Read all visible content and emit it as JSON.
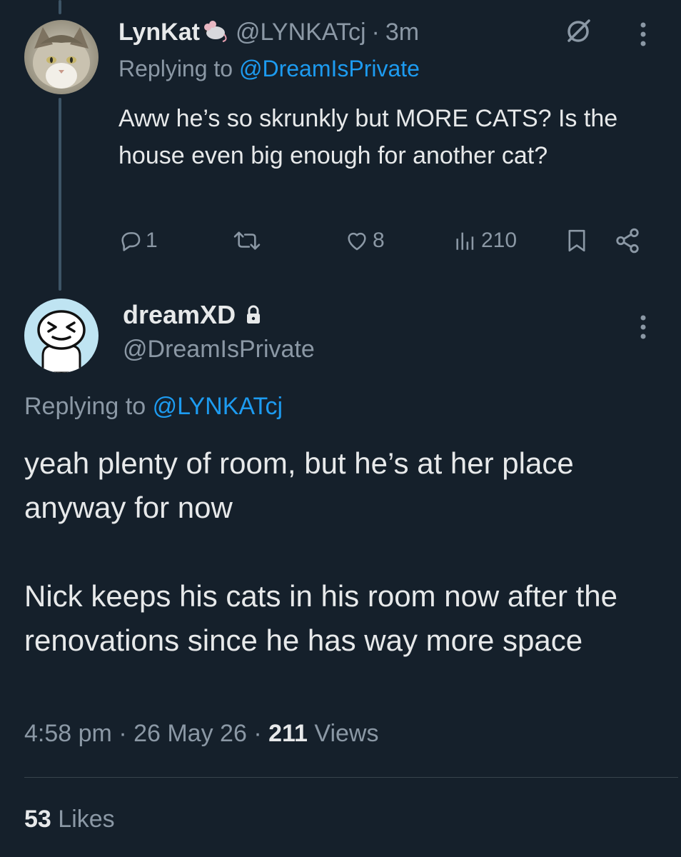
{
  "reply_tweet": {
    "display_name": "LynKat",
    "handle": "@LYNKATcj",
    "separator": "·",
    "time": "3m",
    "replying_prefix": "Replying to",
    "replying_to": "@DreamIsPrivate",
    "text": "Aww he’s so skrunkly but MORE CATS? Is the house even big enough for another cat?",
    "actions": {
      "reply_count": "1",
      "retweet_count": "",
      "like_count": "8",
      "view_count": "210"
    }
  },
  "main_tweet": {
    "display_name": "dreamXD",
    "handle": "@DreamIsPrivate",
    "replying_prefix": "Replying to",
    "replying_to": "@LYNKATcj",
    "paragraphs": [
      "yeah plenty of room, but he’s at her place anyway for now",
      "Nick keeps his cats in his room now after the renovations since he has way more space"
    ],
    "time": "4:58 pm",
    "date": "26 May 26",
    "separator": "·",
    "views_count": "211",
    "views_label": "Views",
    "likes_count": "53",
    "likes_label": "Likes"
  },
  "icons": {
    "reply": "reply-icon",
    "retweet": "retweet-icon",
    "like": "heart-icon",
    "views": "views-icon",
    "bookmark": "bookmark-icon",
    "share": "share-icon",
    "grok": "grok-icon",
    "more": "more-vertical-icon",
    "lock": "lock-icon"
  },
  "colors": {
    "background": "#15202b",
    "text": "#e7e9ea",
    "muted": "#8b98a5",
    "link": "#1d9bf0"
  }
}
